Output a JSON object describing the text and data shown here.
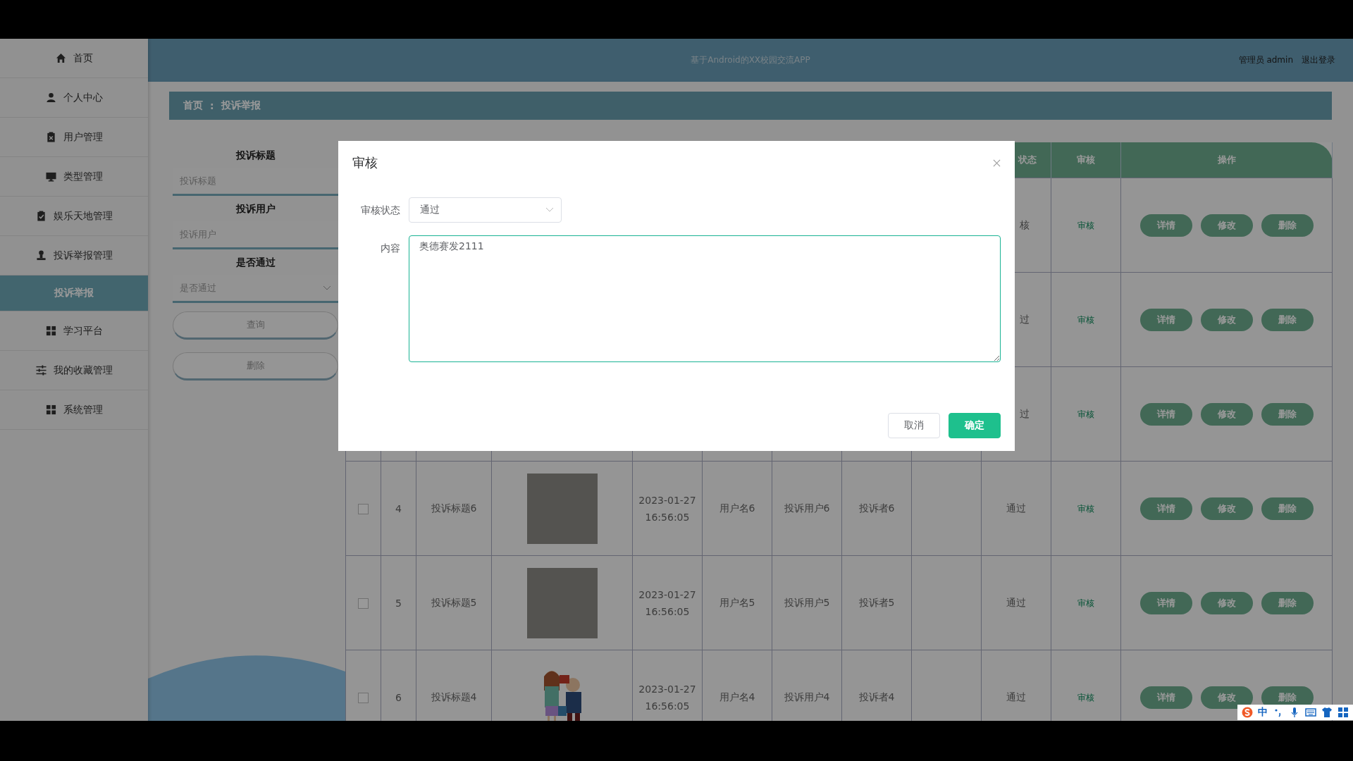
{
  "sidebar": {
    "items": [
      {
        "label": "首页",
        "selected": false
      },
      {
        "label": "个人中心",
        "selected": false
      },
      {
        "label": "用户管理",
        "selected": false
      },
      {
        "label": "类型管理",
        "selected": false
      },
      {
        "label": "娱乐天地管理",
        "selected": false
      },
      {
        "label": "投诉举报管理",
        "selected": false
      },
      {
        "label": "投诉举报",
        "selected": true,
        "kind": "sub"
      },
      {
        "label": "学习平台",
        "selected": false
      },
      {
        "label": "我的收藏管理",
        "selected": false
      },
      {
        "label": "系统管理",
        "selected": false
      }
    ]
  },
  "header": {
    "title": "基于Android的XX校园交流APP",
    "user": "管理员 admin",
    "logout": "退出登录"
  },
  "breadcrumb": {
    "items": [
      "首页",
      "投诉举报"
    ],
    "separator": ":"
  },
  "search": {
    "fields": [
      {
        "label": "投诉标题",
        "placeholder": "投诉标题",
        "kind": "input"
      },
      {
        "label": "投诉用户",
        "placeholder": "投诉用户",
        "kind": "input"
      },
      {
        "label": "是否通过",
        "placeholder": "是否通过",
        "kind": "select"
      }
    ],
    "buttons": [
      "查询",
      "删除"
    ]
  },
  "table": {
    "columns": {
      "status": "状态",
      "review": "审核",
      "actions": "操作"
    },
    "rows": [
      {
        "status": "核",
        "review": "审核",
        "actions": [
          "详情",
          "修改",
          "删除"
        ]
      },
      {
        "status": "过",
        "review": "审核",
        "actions": [
          "详情",
          "修改",
          "删除"
        ]
      },
      {
        "status": "过",
        "review": "审核",
        "actions": [
          "详情",
          "修改",
          "删除"
        ]
      },
      {
        "checked": false,
        "index": "4",
        "title": "投诉标题6",
        "image": {
          "kind": "photo"
        },
        "time": "2023-01-27 16:56:05",
        "username": "用户名6",
        "target": "投诉用户6",
        "reporter": "投诉者6",
        "status": "通过",
        "review": "审核",
        "actions": [
          "详情",
          "修改",
          "删除"
        ]
      },
      {
        "checked": false,
        "index": "5",
        "title": "投诉标题5",
        "image": {
          "kind": "photo"
        },
        "time": "2023-01-27 16:56:05",
        "username": "用户名5",
        "target": "投诉用户5",
        "reporter": "投诉者5",
        "status": "通过",
        "review": "审核",
        "actions": [
          "详情",
          "修改",
          "删除"
        ]
      },
      {
        "checked": false,
        "index": "6",
        "title": "投诉标题4",
        "image": {
          "kind": "illustration"
        },
        "time": "2023-01-27 16:56:05",
        "username": "用户名4",
        "target": "投诉用户4",
        "reporter": "投诉者4",
        "status": "通过",
        "review": "审核",
        "actions": [
          "详情",
          "修改",
          "删除"
        ]
      }
    ]
  },
  "dialog": {
    "title": "审核",
    "fields": [
      {
        "label": "审核状态",
        "value": "通过",
        "kind": "select"
      },
      {
        "label": "内容",
        "value": "奥德赛发2111",
        "kind": "textarea"
      }
    ],
    "buttons": [
      {
        "label": "取消",
        "kind": "default"
      },
      {
        "label": "确定",
        "kind": "primary"
      }
    ]
  },
  "ime_bar": {
    "mode": "中"
  }
}
